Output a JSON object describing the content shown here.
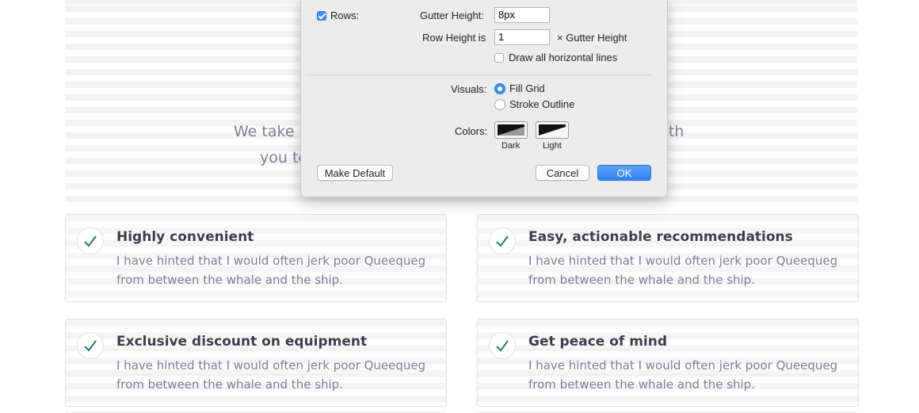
{
  "page": {
    "intro_line1_start": "We take i",
    "intro_line1_end": "with",
    "intro_line2_start": "you to"
  },
  "features": [
    {
      "title": "Highly convenient",
      "description": "I have hinted that I would often jerk poor Queequeg from between the whale and the ship."
    },
    {
      "title": "Easy, actionable recommendations",
      "description": "I have hinted that I would often jerk poor Queequeg from between the whale and the ship."
    },
    {
      "title": "Exclusive discount on equipment",
      "description": "I have hinted that I would often jerk poor Queequeg from between the whale and the ship."
    },
    {
      "title": "Get peace of mind",
      "description": "I have hinted that I would often jerk poor Queequeg from between the whale and the ship."
    }
  ],
  "dialog": {
    "rows_label": "Rows:",
    "rows_checked": true,
    "gutter_height_label": "Gutter Height:",
    "gutter_height_value": "8px",
    "row_height_label": "Row Height is",
    "row_height_value": "1",
    "row_height_suffix": "× Gutter Height",
    "draw_lines_label": "Draw all horizontal lines",
    "draw_lines_checked": false,
    "visuals_label": "Visuals:",
    "visual_options": [
      {
        "label": "Fill Grid",
        "selected": true
      },
      {
        "label": "Stroke Outline",
        "selected": false
      }
    ],
    "colors_label": "Colors:",
    "color_swatches": [
      {
        "label": "Dark"
      },
      {
        "label": "Light"
      }
    ],
    "make_default_label": "Make Default",
    "cancel_label": "Cancel",
    "ok_label": "OK"
  },
  "colors": {
    "accent": "#3a8ef6",
    "check": "#1f7a7a",
    "heading": "#3b3e4c",
    "body_text": "#7b7f8e"
  }
}
